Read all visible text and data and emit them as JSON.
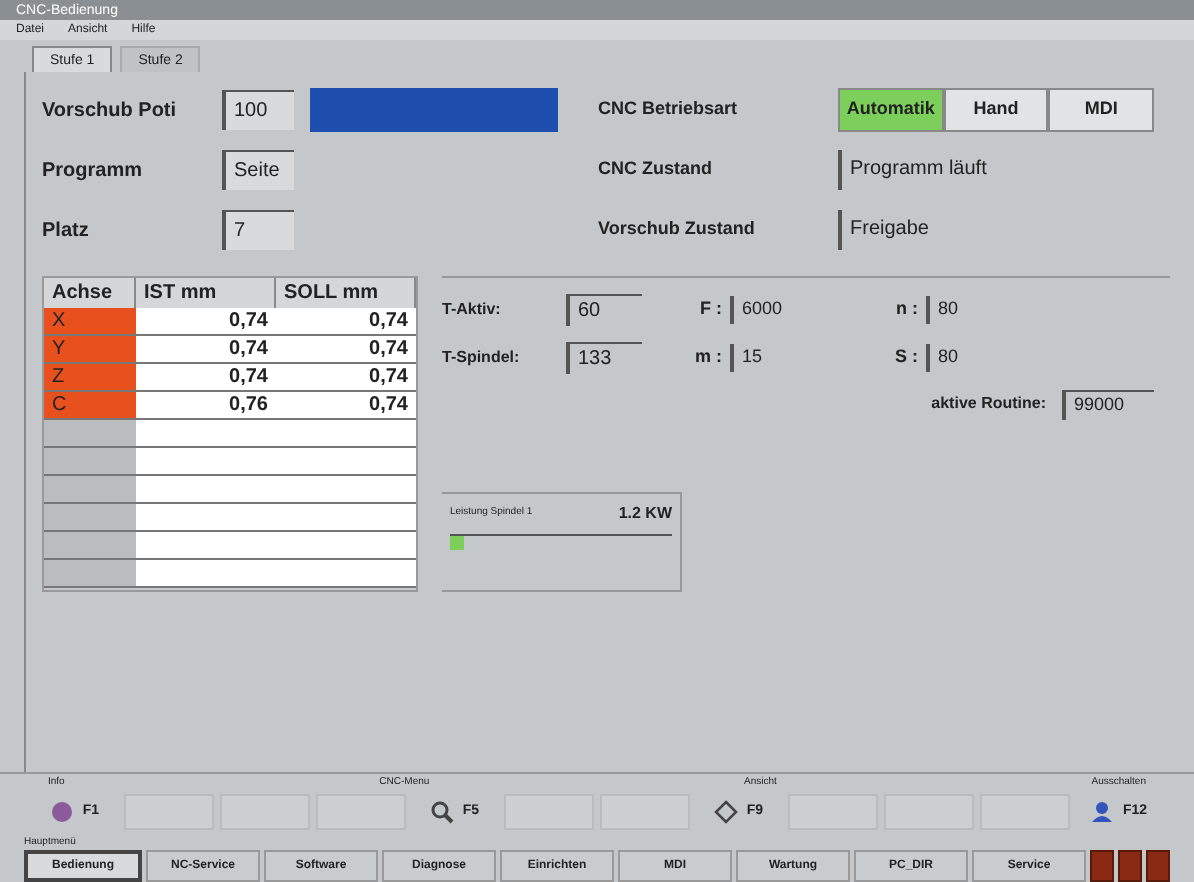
{
  "window": {
    "title": "CNC-Bedienung"
  },
  "menu": [
    "Datei",
    "Ansicht",
    "Hilfe"
  ],
  "tabs": [
    {
      "label": "Stufe 1",
      "selected": true
    },
    {
      "label": "Stufe 2",
      "selected": false
    }
  ],
  "params": [
    {
      "label": "Vorschub Poti",
      "value": "100"
    },
    {
      "label": "Programm",
      "value": "Seite"
    },
    {
      "label": "Platz",
      "value": "7"
    }
  ],
  "mode": {
    "label": "CNC Betriebsart",
    "options": [
      {
        "label": "Automatik",
        "selected": true
      },
      {
        "label": "Hand",
        "selected": false
      },
      {
        "label": "MDI",
        "selected": false
      }
    ]
  },
  "status": [
    {
      "label": "CNC Zustand",
      "value": "Programm läuft"
    },
    {
      "label": "Vorschub Zustand",
      "value": "Freigabe"
    }
  ],
  "axes": {
    "columns": [
      "Achse",
      "IST mm",
      "SOLL mm"
    ],
    "rows": [
      {
        "axis": "X",
        "ist": "0,74",
        "soll": "0,74"
      },
      {
        "axis": "Y",
        "ist": "0,74",
        "soll": "0,74"
      },
      {
        "axis": "Z",
        "ist": "0,74",
        "soll": "0,74"
      },
      {
        "axis": "C",
        "ist": "0,76",
        "soll": "0,74"
      }
    ]
  },
  "tool": [
    {
      "label": "T-Aktiv:",
      "value": "60"
    },
    {
      "label": "T-Spindel:",
      "value": "133"
    }
  ],
  "speeds": [
    {
      "label": "F :",
      "value": "6000"
    },
    {
      "label": "m :",
      "value": "15"
    }
  ],
  "speeds2": [
    {
      "label": "n :",
      "value": "80"
    },
    {
      "label": "S :",
      "value": "80"
    }
  ],
  "routine": {
    "label": "aktive Routine:",
    "value": "99000"
  },
  "spindle": {
    "label": "Leistung Spindel 1",
    "reading": "1.2 KW",
    "level": 0.06
  },
  "fkey_groups": [
    "Info",
    "CNC-Menu",
    "Ansicht",
    "Ausschalten"
  ],
  "fkeys": [
    {
      "kind": "icon",
      "label": "F1"
    },
    {
      "kind": "blank"
    },
    {
      "kind": "blank"
    },
    {
      "kind": "blank"
    },
    {
      "kind": "icon",
      "label": "F5"
    },
    {
      "kind": "blank"
    },
    {
      "kind": "blank"
    },
    {
      "kind": "icon",
      "label": "F9"
    },
    {
      "kind": "blank"
    },
    {
      "kind": "blank"
    },
    {
      "kind": "blank"
    },
    {
      "kind": "icon",
      "label": "F12"
    }
  ],
  "bottom_label": "Hauptmenü",
  "bottom_tabs": [
    {
      "label": "Bedienung",
      "selected": true
    },
    {
      "label": "NC-Service",
      "selected": false
    },
    {
      "label": "Software",
      "selected": false
    },
    {
      "label": "Diagnose",
      "selected": false
    },
    {
      "label": "Einrichten",
      "selected": false
    },
    {
      "label": "MDI",
      "selected": false
    },
    {
      "label": "Wartung",
      "selected": false
    },
    {
      "label": "PC_DIR",
      "selected": false
    },
    {
      "label": "Service",
      "selected": false
    }
  ]
}
